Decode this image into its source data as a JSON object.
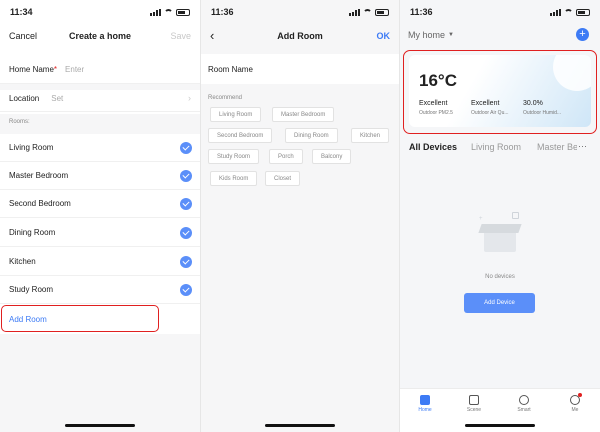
{
  "screen1": {
    "time": "11:34",
    "cancel": "Cancel",
    "title": "Create a home",
    "save": "Save",
    "home_name_label": "Home Name",
    "home_name_required": "*",
    "home_name_placeholder": "Enter",
    "location_label": "Location",
    "location_value": "Set",
    "rooms_header": "Rooms:",
    "rooms": [
      "Living Room",
      "Master Bedroom",
      "Second Bedroom",
      "Dining Room",
      "Kitchen",
      "Study Room"
    ],
    "add_room": "Add Room"
  },
  "screen2": {
    "time": "11:36",
    "title": "Add Room",
    "ok": "OK",
    "room_name_label": "Room Name",
    "recommend_label": "Recommend",
    "chips": [
      "Living Room",
      "Master Bedroom",
      "Second Bedroom",
      "Dining Room",
      "Kitchen",
      "Study Room",
      "Porch",
      "Balcony",
      "Kids Room",
      "Closet"
    ]
  },
  "screen3": {
    "time": "11:36",
    "home_selector": "My home",
    "temperature": "16°C",
    "weather": [
      {
        "value": "Excellent",
        "label": "Outdoor PM2.5"
      },
      {
        "value": "Excellent",
        "label": "Outdoor Air Qu..."
      },
      {
        "value": "30.0%",
        "label": "Outdoor Humid..."
      }
    ],
    "tabs": [
      "All Devices",
      "Living Room",
      "Master Be"
    ],
    "more": "···",
    "no_devices": "No devices",
    "add_device": "Add Device",
    "nav": [
      "Home",
      "Scene",
      "Smart",
      "Me"
    ]
  },
  "colors": {
    "accent": "#5b8ff9",
    "highlight": "#e02020"
  }
}
